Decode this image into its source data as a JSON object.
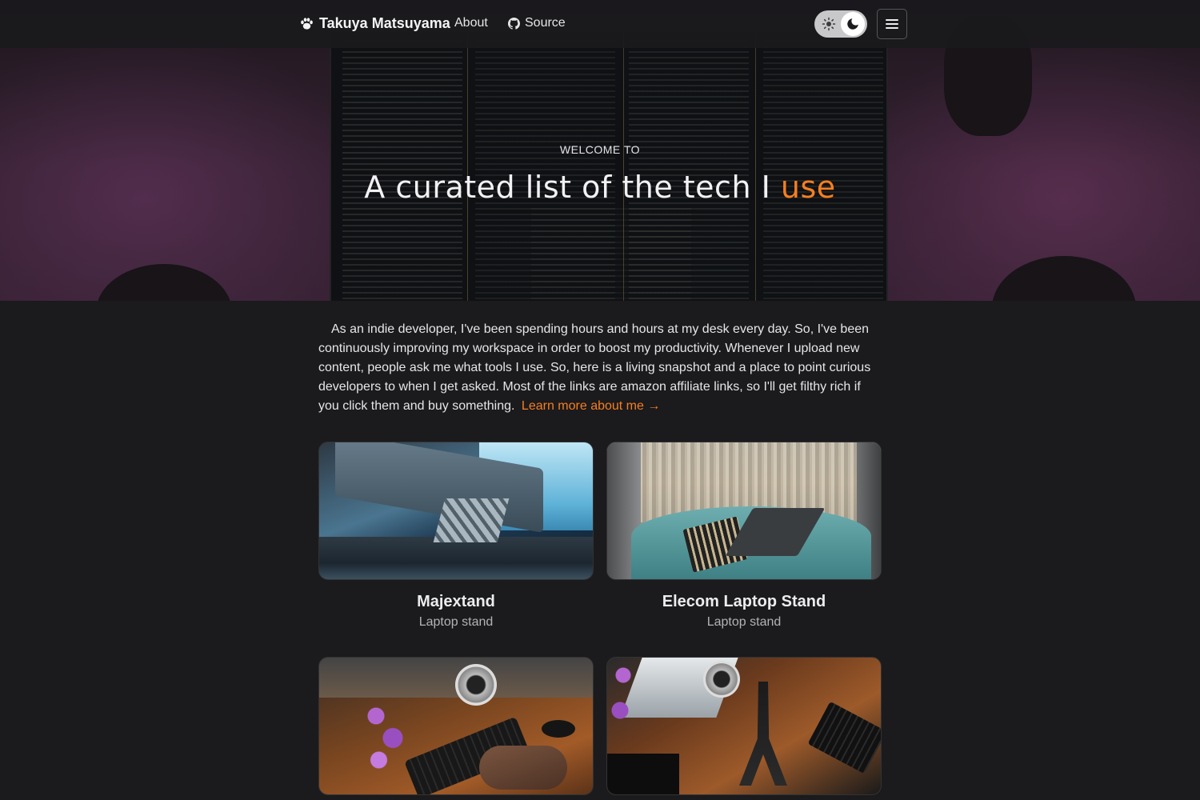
{
  "nav": {
    "brand": "Takuya Matsuyama",
    "about_label": "About",
    "source_label": "Source"
  },
  "hero": {
    "eyebrow": "WELCOME TO",
    "headline_main": "A curated list of the tech I",
    "headline_accent": "use",
    "accent_color": "#f57f20"
  },
  "intro": {
    "text": "As an indie developer, I've been spending hours and hours at my desk every day. So, I've been continuously improving my workspace in order to boost my productivity. Whenever I upload new content, people ask me what tools I use. So, here is a living snapshot and a place to point curious developers to when I get asked. Most of the links are amazon affiliate links, so I'll get filthy rich if you click them and buy something.",
    "learn_more": "Learn more about me →"
  },
  "cards": [
    {
      "title": "Majextand",
      "subtitle": "Laptop stand"
    },
    {
      "title": "Elecom Laptop Stand",
      "subtitle": "Laptop stand"
    },
    {
      "title": "",
      "subtitle": ""
    },
    {
      "title": "",
      "subtitle": ""
    }
  ],
  "icons": {
    "brand": "paw-icon",
    "source": "github-icon",
    "light_mode": "sun-icon",
    "dark_mode": "moon-icon",
    "menu": "hamburger-menu-icon"
  }
}
